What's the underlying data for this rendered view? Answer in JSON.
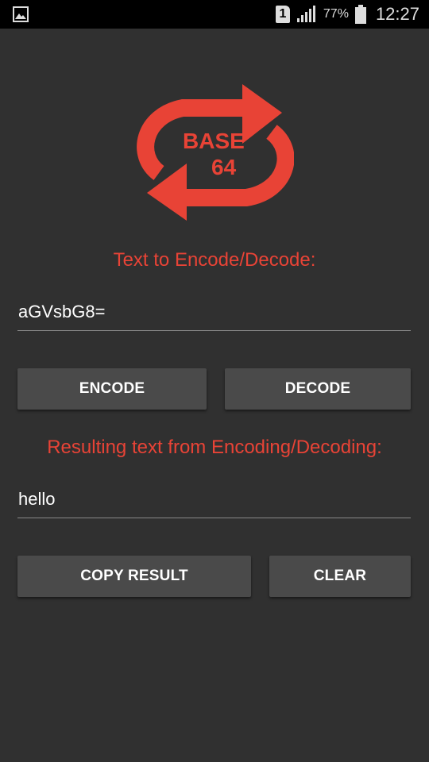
{
  "status_bar": {
    "sim_label": "1",
    "battery_percent": "77%",
    "time": "12:27",
    "icons": [
      "gallery-icon",
      "sim-icon",
      "signal-icon",
      "battery-icon"
    ]
  },
  "logo": {
    "line1": "BASE",
    "line2": "64",
    "color": "#e84336"
  },
  "input_section": {
    "label": "Text to Encode/Decode:",
    "value": "aGVsbG8="
  },
  "buttons_row1": {
    "encode_label": "ENCODE",
    "decode_label": "DECODE"
  },
  "result_section": {
    "label": "Resulting text from Encoding/Decoding:",
    "value": "hello"
  },
  "buttons_row2": {
    "copy_label": "COPY RESULT",
    "clear_label": "CLEAR"
  },
  "colors": {
    "background": "#303030",
    "accent": "#e84336",
    "button": "#4a4a4a"
  }
}
